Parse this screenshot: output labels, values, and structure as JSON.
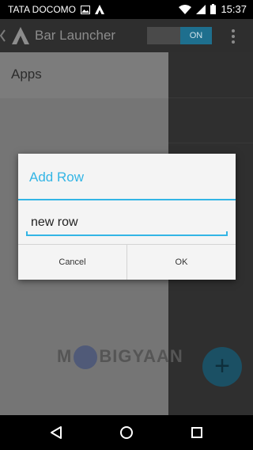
{
  "status_bar": {
    "carrier": "TATA DOCOMO",
    "time": "15:37",
    "icons": [
      "image-icon",
      "app-notification-icon",
      "wifi-icon",
      "signal-icon",
      "battery-icon"
    ]
  },
  "action_bar": {
    "title": "Bar Launcher",
    "toggle_label": "ON",
    "icons": [
      "bar-launcher-logo-icon",
      "overflow-menu-icon"
    ]
  },
  "drawer": {
    "header": "Apps"
  },
  "dialog": {
    "title": "Add Row",
    "input_value": "new row",
    "cancel_label": "Cancel",
    "ok_label": "OK"
  },
  "watermark": {
    "text_left": "M",
    "text_right": "BIGYAAN"
  },
  "fab": {
    "label": "+",
    "icon": "add-icon"
  },
  "nav_bar": {
    "icons": [
      "back-icon",
      "home-icon",
      "recents-icon"
    ]
  },
  "colors": {
    "accent": "#33b5e5",
    "toggle_on": "#1e6f8e",
    "fab": "#1b5064"
  }
}
